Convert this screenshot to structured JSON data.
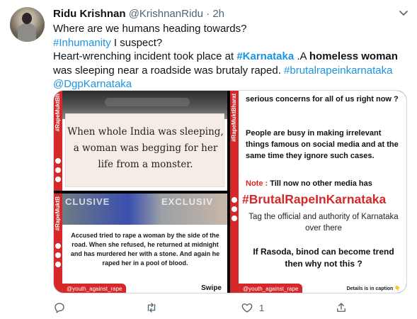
{
  "tweet": {
    "display_name": "Ridu Krishnan",
    "handle": "@KrishnanRidu",
    "dot": "·",
    "time": "2h",
    "lines": [
      [
        {
          "t": "Where are we humans heading towards?"
        }
      ],
      [
        {
          "t": "#Inhumanity",
          "link": true
        },
        {
          "t": " I suspect?"
        }
      ],
      [
        {
          "t": "Heart-wrenching incident took place at "
        },
        {
          "t": "#Karnataka",
          "link": true,
          "bold": true
        },
        {
          "t": " .A "
        },
        {
          "t": "homeless woman",
          "bold": true
        }
      ],
      [
        {
          "t": "was sleeping near a roadside was brutaly raped. "
        },
        {
          "t": "#brutalrapeinkarnataka",
          "link": true
        }
      ],
      [
        {
          "t": "@DgpKarnataka",
          "link": true
        }
      ]
    ]
  },
  "media": {
    "top_left": {
      "vertical_tag": "#RapeMuktBh",
      "quote": "When whole India was sleeping, a woman was begging for her life from a monster."
    },
    "bottom_left": {
      "vertical_tag": "#RapeMuktB",
      "overlay_left": "CLUSIVE",
      "overlay_right": "EXCLUSIV",
      "body": "Accused tried to rape a woman by the side of the road. When she refused, he returned at midnight and has murdered her with a stone. And again he raped her in a pool of blood.",
      "footer_tag": "@youth_against_rape",
      "swipe": "Swipe"
    },
    "right": {
      "vertical_tag": "#RapeMuktBharat",
      "top": "serious concerns for all of us right now ?",
      "paragraph": "People are busy in making irrelevant things famous on social media and at the same time they ignore such cases.",
      "note_label": "Note :",
      "note_text": " Till now no other media has",
      "hashtag": "#BrutalRapeInKarnataka",
      "tag_line": "Tag the official and authority of Karnataka over there",
      "question": "If Rasoda, binod can become trend then why not this ?",
      "footer_tag": "@youth_against_rape",
      "caption": "Details is in caption",
      "hand": "👇"
    }
  },
  "actions": {
    "reply_count": "",
    "retweet_count": "",
    "like_count": "1",
    "share_count": ""
  },
  "colors": {
    "link": "#1b95e0",
    "brand_red": "#d62828",
    "muted": "#536471"
  },
  "icons": [
    "caret-down-icon",
    "reply-icon",
    "retweet-icon",
    "like-icon",
    "share-icon"
  ]
}
